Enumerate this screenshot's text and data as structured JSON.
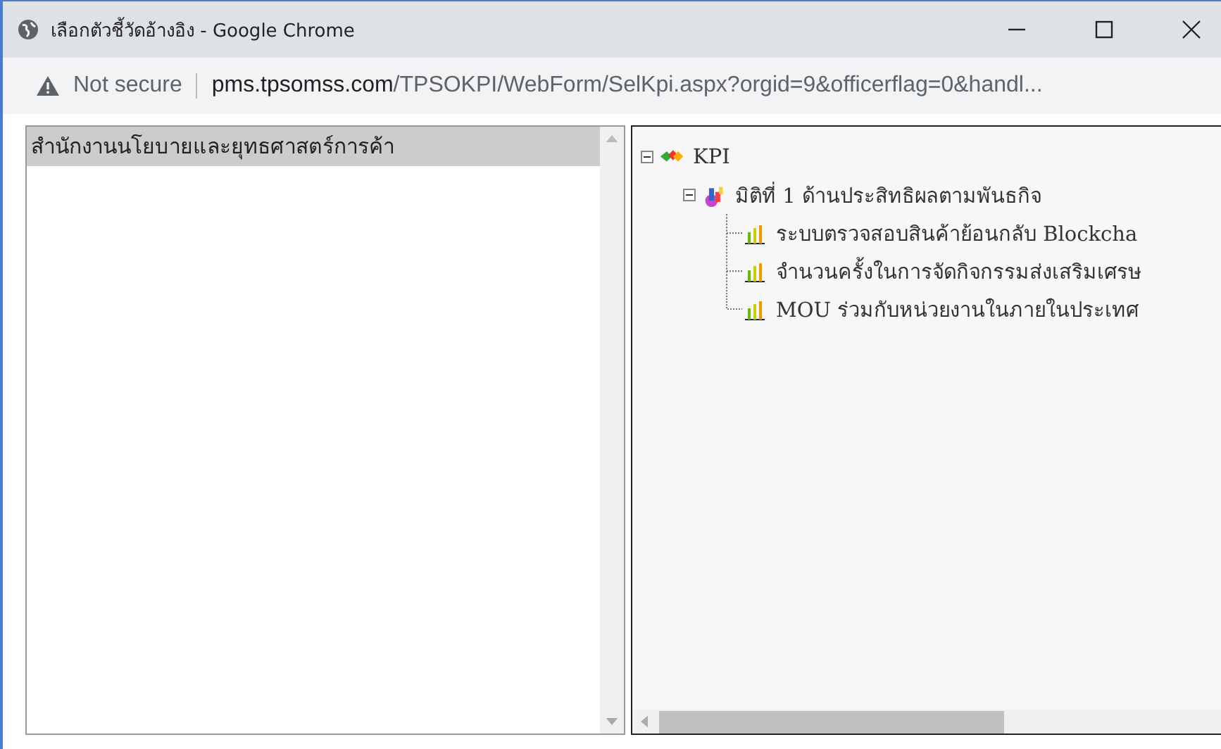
{
  "window": {
    "title": "เลือกตัวชี้วัดอ้างอิง - Google Chrome"
  },
  "address_bar": {
    "security": "Not secure",
    "url_domain": "pms.tpsomss.com",
    "url_path": "/TPSOKPI/WebForm/SelKpi.aspx?orgid=9&officerflag=0&handl..."
  },
  "org_list": {
    "items": [
      {
        "label": "สำนักงานนโยบายและยุทธศาสตร์การค้า",
        "selected": true
      }
    ]
  },
  "tree": [
    {
      "label": "KPI",
      "kind": "root",
      "expanded": true,
      "children": [
        {
          "label": "มิติที่ 1 ด้านประสิทธิผลตามพันธกิจ",
          "kind": "group",
          "expanded": true,
          "children": [
            {
              "label": "ระบบตรวจสอบสินค้าย้อนกลับ Blockcha",
              "kind": "kpi"
            },
            {
              "label": "จำนวนครั้งในการจัดกิจกรรมส่งเสริมเศรษ",
              "kind": "kpi"
            },
            {
              "label": "MOU ร่วมกับหน่วยงานในภายในประเทศ",
              "kind": "kpi"
            }
          ]
        }
      ]
    }
  ]
}
